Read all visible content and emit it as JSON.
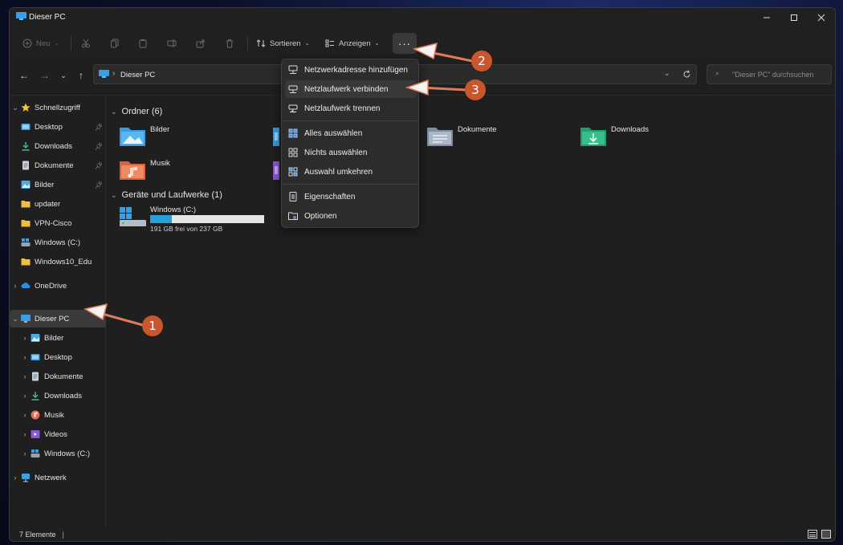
{
  "window": {
    "title": "Dieser PC"
  },
  "toolbar": {
    "new_label": "Neu",
    "sort_label": "Sortieren",
    "view_label": "Anzeigen",
    "more_label": "···"
  },
  "address": {
    "location": "Dieser PC"
  },
  "search": {
    "placeholder": "\"Dieser PC\" durchsuchen"
  },
  "sidebar": {
    "quick_access": "Schnellzugriff",
    "quick_items": [
      "Desktop",
      "Downloads",
      "Dokumente",
      "Bilder",
      "updater",
      "VPN-Cisco",
      "Windows (C:)",
      "Windows10_Edu"
    ],
    "onedrive": "OneDrive",
    "this_pc": "Dieser PC",
    "pc_items": [
      "Bilder",
      "Desktop",
      "Dokumente",
      "Downloads",
      "Musik",
      "Videos",
      "Windows (C:)"
    ],
    "network": "Netzwerk"
  },
  "content": {
    "folders_header": "Ordner (6)",
    "folders": [
      "Bilder",
      "Dokumente",
      "Downloads",
      "Musik"
    ],
    "drives_header": "Geräte und Laufwerke (1)",
    "drive": {
      "name": "Windows (C:)",
      "free_text": "191 GB frei von 237 GB",
      "used_fraction": 0.19
    }
  },
  "menu": {
    "items": [
      "Netzwerkadresse hinzufügen",
      "Netzlaufwerk verbinden",
      "Netzlaufwerk trennen",
      "Alles auswählen",
      "Nichts auswählen",
      "Auswahl umkehren",
      "Eigenschaften",
      "Optionen"
    ]
  },
  "status": {
    "count": "7 Elemente"
  },
  "annotations": [
    "1",
    "2",
    "3"
  ],
  "colors": {
    "accent": "#4cc2ff",
    "badge": "#c9562c",
    "arrow": "#e07a5a"
  }
}
